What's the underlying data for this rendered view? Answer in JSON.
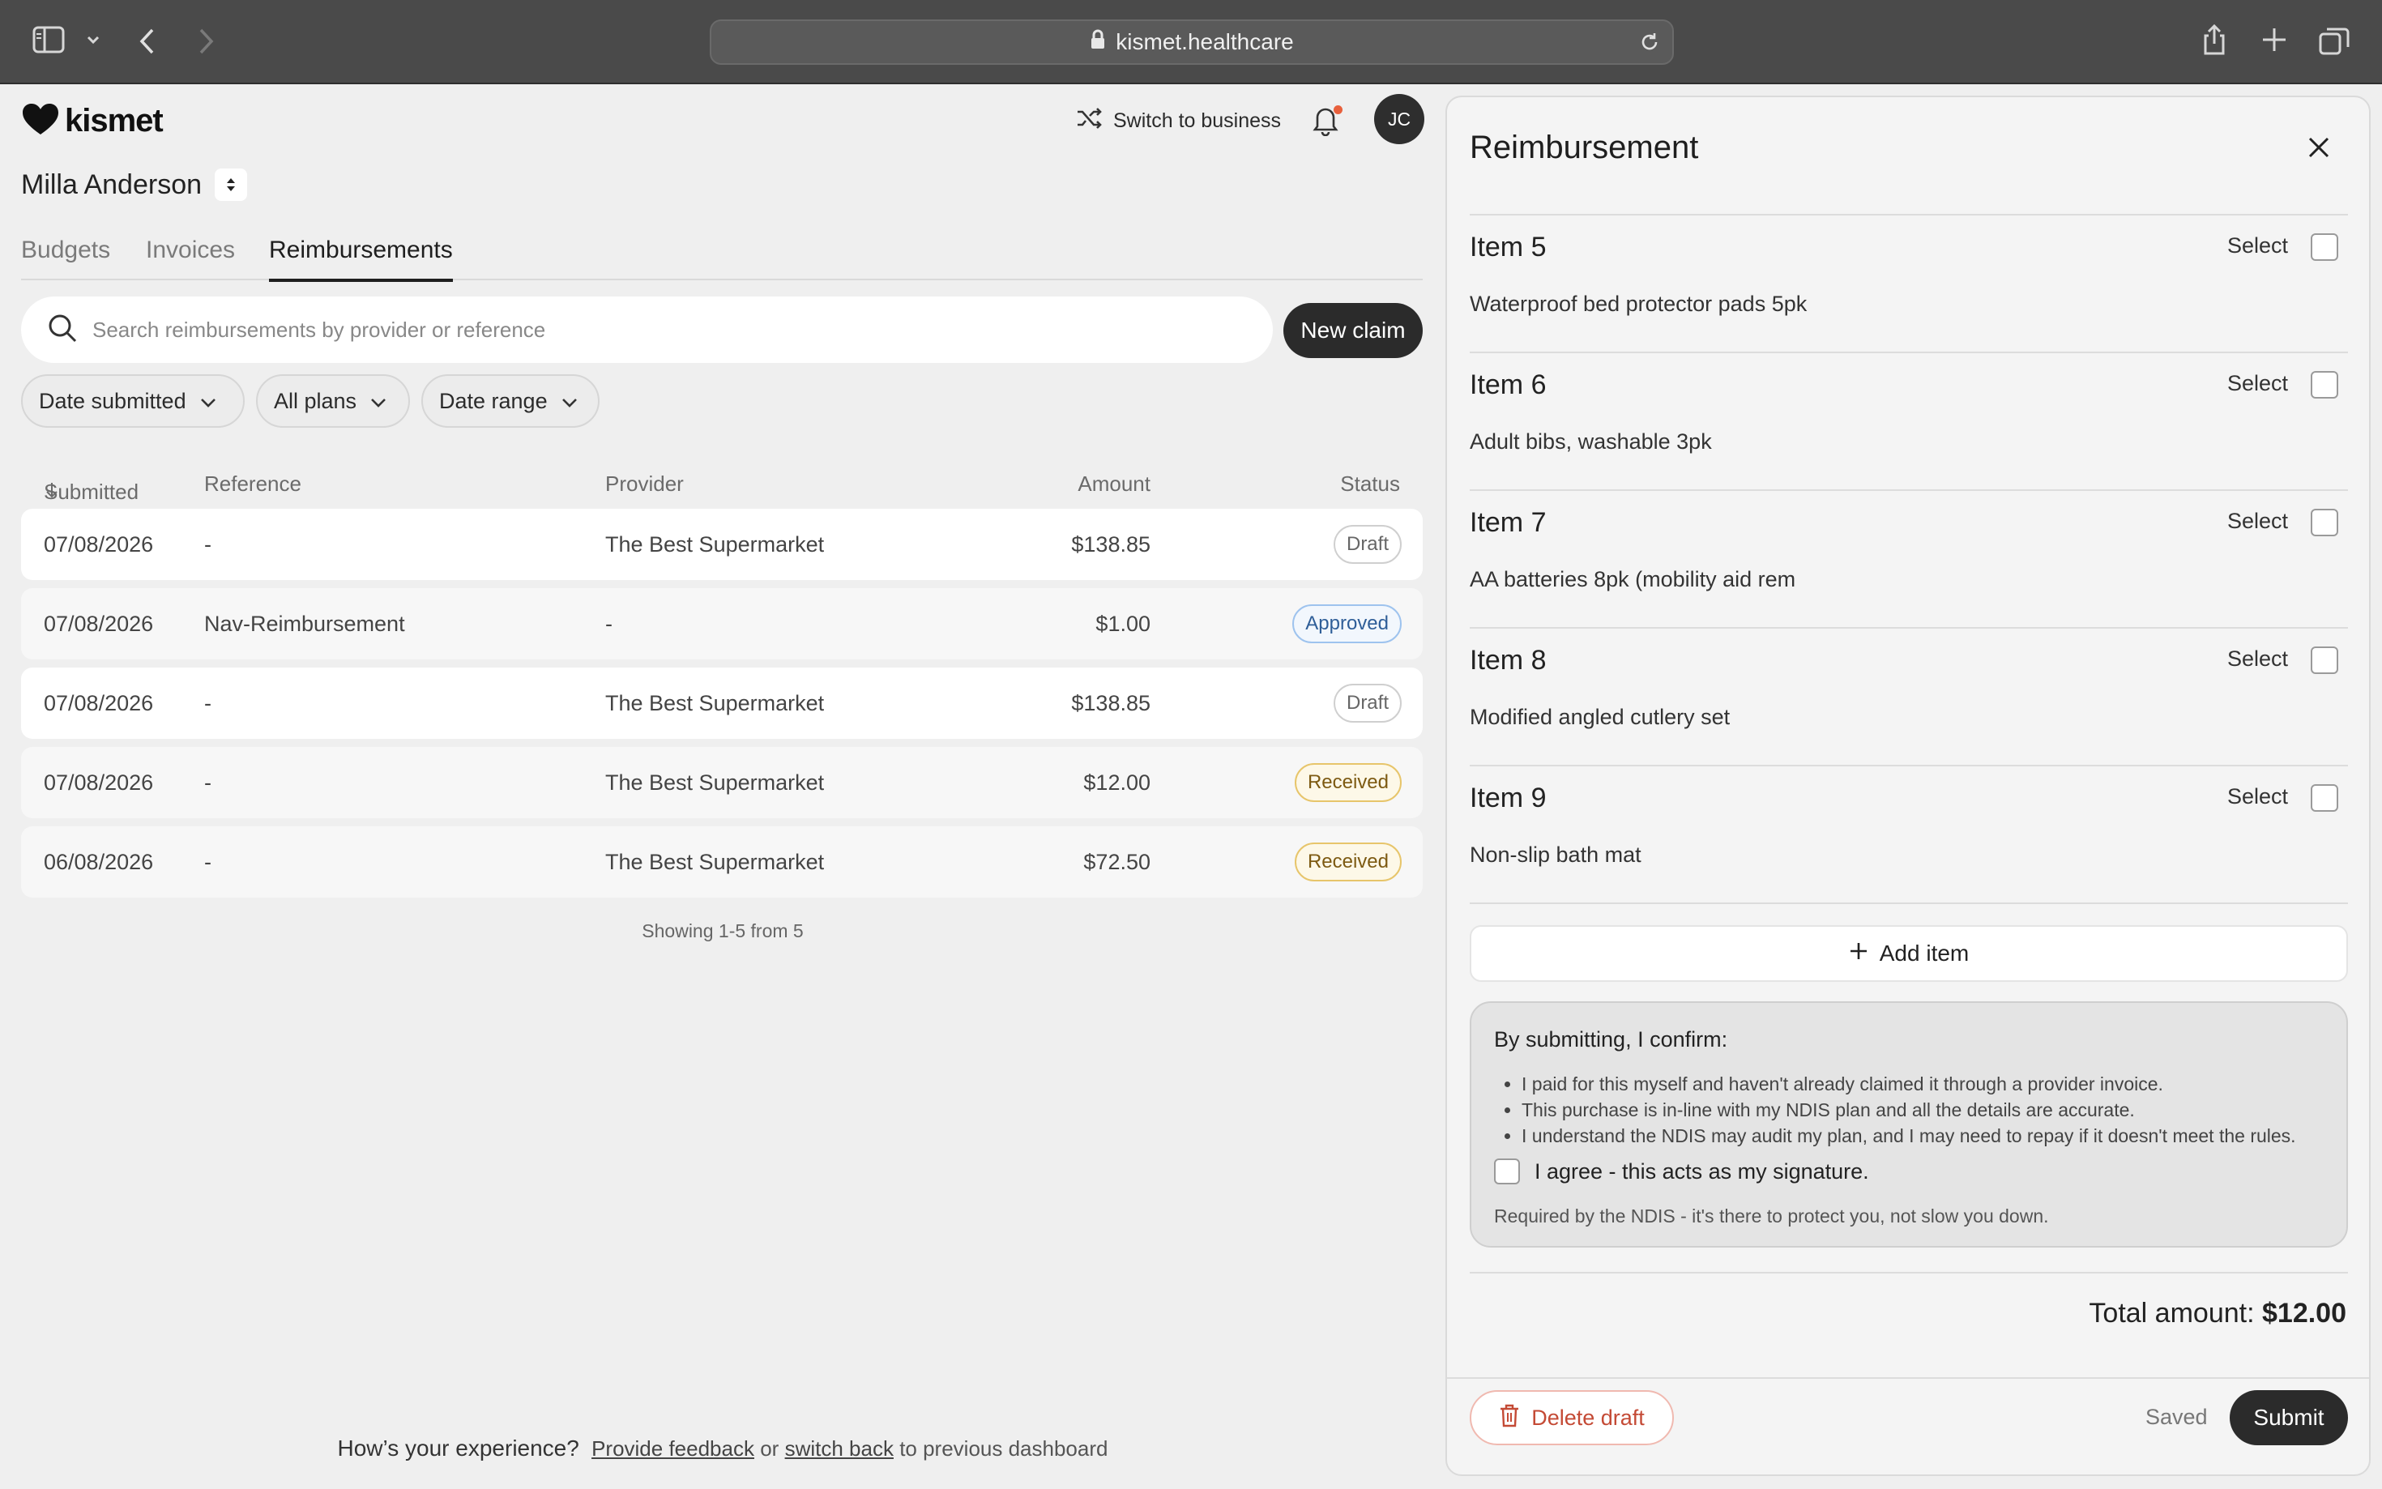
{
  "browser": {
    "url": "kismet.healthcare",
    "icons": [
      "sidebar-icon",
      "chevron-down-icon",
      "back-icon",
      "forward-icon",
      "lock-icon",
      "reload-icon",
      "share-icon",
      "new-tab-icon",
      "tabs-overview-icon"
    ]
  },
  "app": {
    "logo_text": "kismet",
    "switch_label": "Switch to business",
    "avatar_initials": "JC",
    "notification_dot_color": "#e8603c"
  },
  "participant": {
    "name": "Milla Anderson"
  },
  "tabs": [
    {
      "label": "Budgets",
      "active": false
    },
    {
      "label": "Invoices",
      "active": false
    },
    {
      "label": "Reimbursements",
      "active": true
    }
  ],
  "search": {
    "placeholder": "Search reimbursements by provider or reference",
    "value": ""
  },
  "new_claim_label": "New claim",
  "filters": [
    {
      "label": "Date submitted"
    },
    {
      "label": "All plans"
    },
    {
      "label": "Date range"
    }
  ],
  "table": {
    "headers": {
      "submitted": "Submitted",
      "reference": "Reference",
      "provider": "Provider",
      "amount": "Amount",
      "status": "Status"
    },
    "rows": [
      {
        "submitted": "07/08/2026",
        "reference": "-",
        "provider": "The Best Supermarket",
        "amount": "$138.85",
        "status": "Draft"
      },
      {
        "submitted": "07/08/2026",
        "reference": "Nav-Reimbursement",
        "provider": "-",
        "amount": "$1.00",
        "status": "Approved"
      },
      {
        "submitted": "07/08/2026",
        "reference": "-",
        "provider": "The Best Supermarket",
        "amount": "$138.85",
        "status": "Draft"
      },
      {
        "submitted": "07/08/2026",
        "reference": "-",
        "provider": "The Best Supermarket",
        "amount": "$12.00",
        "status": "Received"
      },
      {
        "submitted": "06/08/2026",
        "reference": "-",
        "provider": "The Best Supermarket",
        "amount": "$72.50",
        "status": "Received"
      }
    ],
    "pagination": "Showing 1-5 from 5"
  },
  "feedback": {
    "lead": "How’s your experience?",
    "link1": "Provide feedback",
    "mid": "or",
    "link2": "switch back",
    "tail": "to previous dashboard"
  },
  "panel": {
    "title": "Reimbursement",
    "select_label": "Select",
    "items": [
      {
        "title": "Item 5",
        "description": "Waterproof bed protector pads 5pk"
      },
      {
        "title": "Item 6",
        "description": "Adult bibs, washable 3pk"
      },
      {
        "title": "Item 7",
        "description": "AA batteries 8pk (mobility aid rem"
      },
      {
        "title": "Item 8",
        "description": "Modified angled cutlery set"
      },
      {
        "title": "Item 9",
        "description": "Non-slip bath mat"
      }
    ],
    "add_item_label": "Add item",
    "confirm": {
      "title": "By submitting, I confirm:",
      "points": [
        "I paid for this myself and haven't already claimed it through a provider invoice.",
        "This purchase is in-line with my NDIS plan and all the details are accurate.",
        "I understand the NDIS may audit my plan, and I may need to repay if it doesn't meet the rules."
      ],
      "agree_label": "I agree - this acts as my signature.",
      "note": "Required by the NDIS - it's there to protect you, not slow you down."
    },
    "total_label": "Total amount:",
    "total_value": "$12.00",
    "delete_label": "Delete draft",
    "saved_label": "Saved",
    "submit_label": "Submit"
  },
  "colors": {
    "accent_dark": "#2b2b2b",
    "approved": "#2f5e98",
    "received": "#7d5a12",
    "danger": "#c44a35"
  }
}
